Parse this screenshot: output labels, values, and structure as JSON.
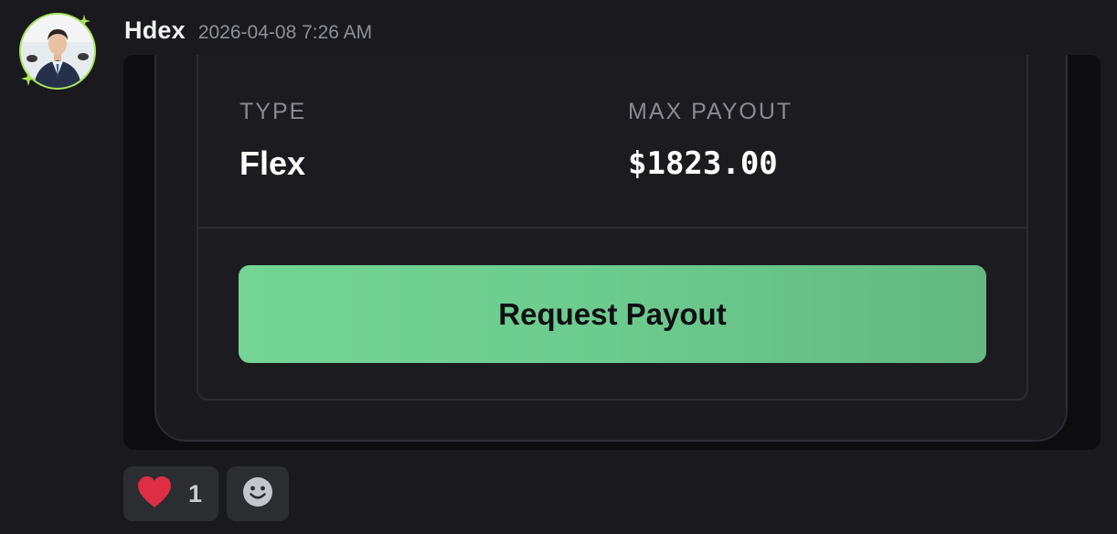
{
  "message": {
    "username": "Hdex",
    "timestamp": "2026-04-08 7:26 AM"
  },
  "embed": {
    "type_label": "TYPE",
    "type_value": "Flex",
    "max_payout_label": "MAX PAYOUT",
    "max_payout_value": "$1823.00",
    "button_label": "Request Payout"
  },
  "reactions": [
    {
      "emoji": "heart-icon",
      "count": "1"
    },
    {
      "emoji": "add-reaction-icon"
    }
  ],
  "colors": {
    "accent_green": "#6ccb8e",
    "avatar_ring": "#a7e35a",
    "heart": "#dd2e44"
  }
}
